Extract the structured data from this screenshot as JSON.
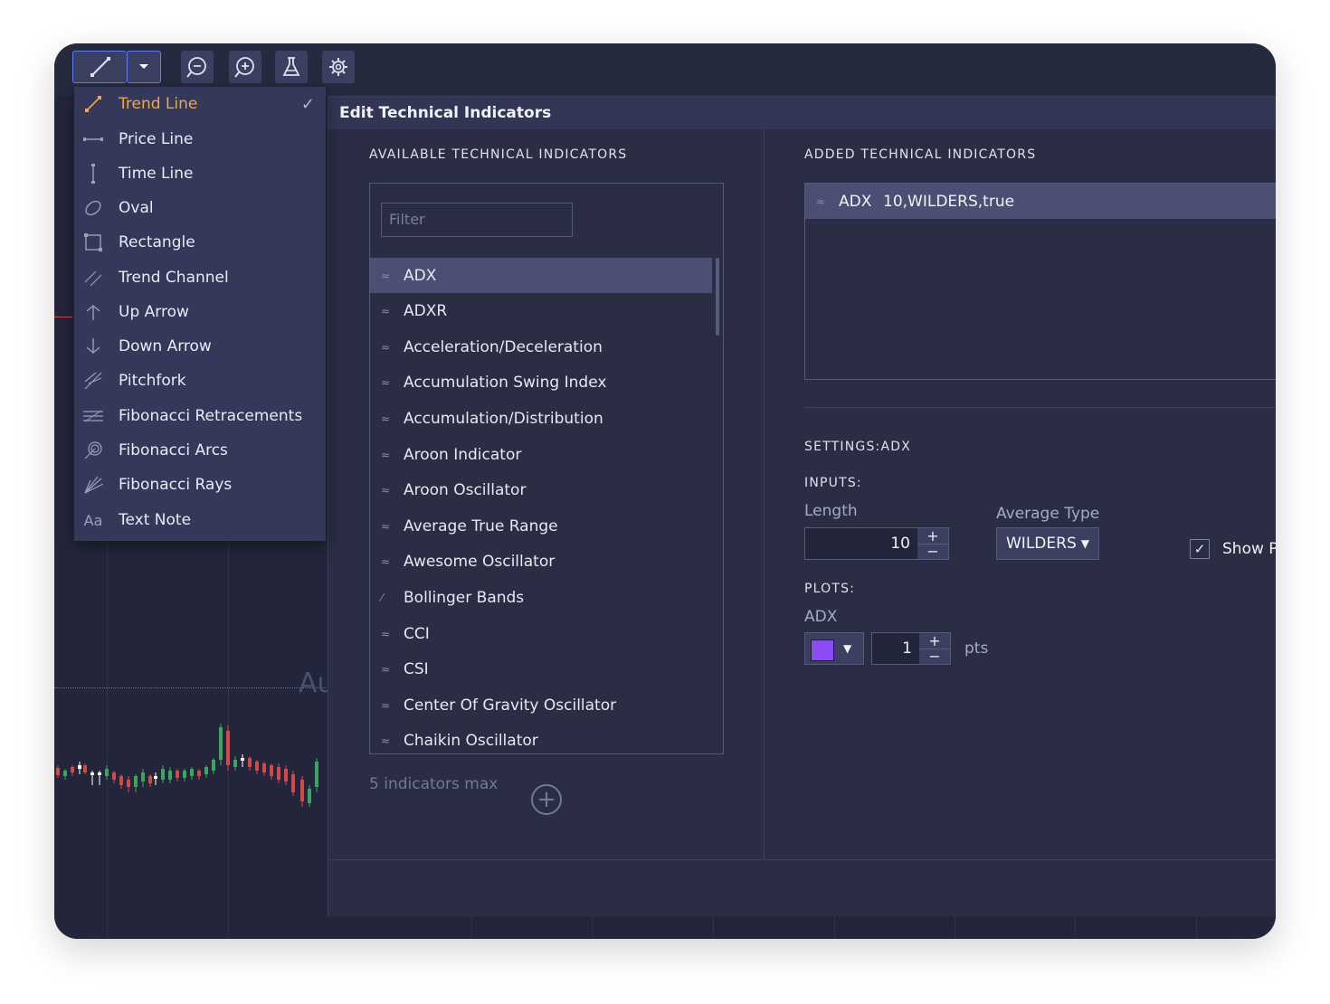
{
  "toolbar": {
    "buttons": [
      "trend-line-tool",
      "dropdown-caret",
      "zoom-out",
      "zoom-in",
      "studies-flask",
      "settings-gear"
    ]
  },
  "draw_menu": {
    "items": [
      {
        "label": "Trend Line",
        "icon": "trend-line-icon",
        "selected": true
      },
      {
        "label": "Price Line",
        "icon": "price-line-icon"
      },
      {
        "label": "Time Line",
        "icon": "time-line-icon"
      },
      {
        "label": "Oval",
        "icon": "oval-icon"
      },
      {
        "label": "Rectangle",
        "icon": "rectangle-icon"
      },
      {
        "label": "Trend Channel",
        "icon": "trend-channel-icon"
      },
      {
        "label": "Up Arrow",
        "icon": "up-arrow-icon"
      },
      {
        "label": "Down Arrow",
        "icon": "down-arrow-icon"
      },
      {
        "label": "Pitchfork",
        "icon": "pitchfork-icon"
      },
      {
        "label": "Fibonacci Retracements",
        "icon": "fib-retracement-icon"
      },
      {
        "label": "Fibonacci Arcs",
        "icon": "fib-arcs-icon"
      },
      {
        "label": "Fibonacci Rays",
        "icon": "fib-rays-icon"
      },
      {
        "label": "Text Note",
        "icon": "text-note-icon",
        "glyph": "Aa"
      }
    ],
    "check": "✓"
  },
  "chart": {
    "ghost_label": "Au"
  },
  "dialog": {
    "title": "Edit Technical Indicators",
    "available_heading": "AVAILABLE TECHNICAL INDICATORS",
    "added_heading": "ADDED TECHNICAL INDICATORS",
    "filter_placeholder": "Filter",
    "available": [
      {
        "name": "ADX",
        "selected": true
      },
      {
        "name": "ADXR"
      },
      {
        "name": "Acceleration/Deceleration"
      },
      {
        "name": "Accumulation Swing Index"
      },
      {
        "name": "Accumulation/Distribution"
      },
      {
        "name": "Aroon Indicator"
      },
      {
        "name": "Aroon Oscillator"
      },
      {
        "name": "Average True Range"
      },
      {
        "name": "Awesome Oscillator"
      },
      {
        "name": "Bollinger Bands",
        "overlay": true
      },
      {
        "name": "CCI"
      },
      {
        "name": "CSI"
      },
      {
        "name": "Center Of Gravity Oscillator"
      },
      {
        "name": "Chaikin Oscillator"
      }
    ],
    "max_note": "5 indicators max",
    "added": [
      {
        "name": "ADX",
        "params": "10,WILDERS,true"
      }
    ],
    "settings_heading": "SETTINGS:ADX",
    "inputs_heading": "INPUTS:",
    "length_label": "Length",
    "length_value": "10",
    "avg_type_label": "Average Type",
    "avg_type_value": "WILDERS",
    "show_label": "Show P",
    "show_checked": true,
    "plots_heading": "PLOTS:",
    "plot_name": "ADX",
    "plot_color": "#8b4cf6",
    "plot_width": "1",
    "plot_unit": "pts",
    "plus": "+",
    "minus": "−"
  },
  "colors": {
    "accent": "#5b7cff",
    "selected_menu_text": "#f2a54a",
    "panel": "#2a2d43",
    "up_candle": "#3aa55c",
    "down_candle": "#d04a4a"
  }
}
